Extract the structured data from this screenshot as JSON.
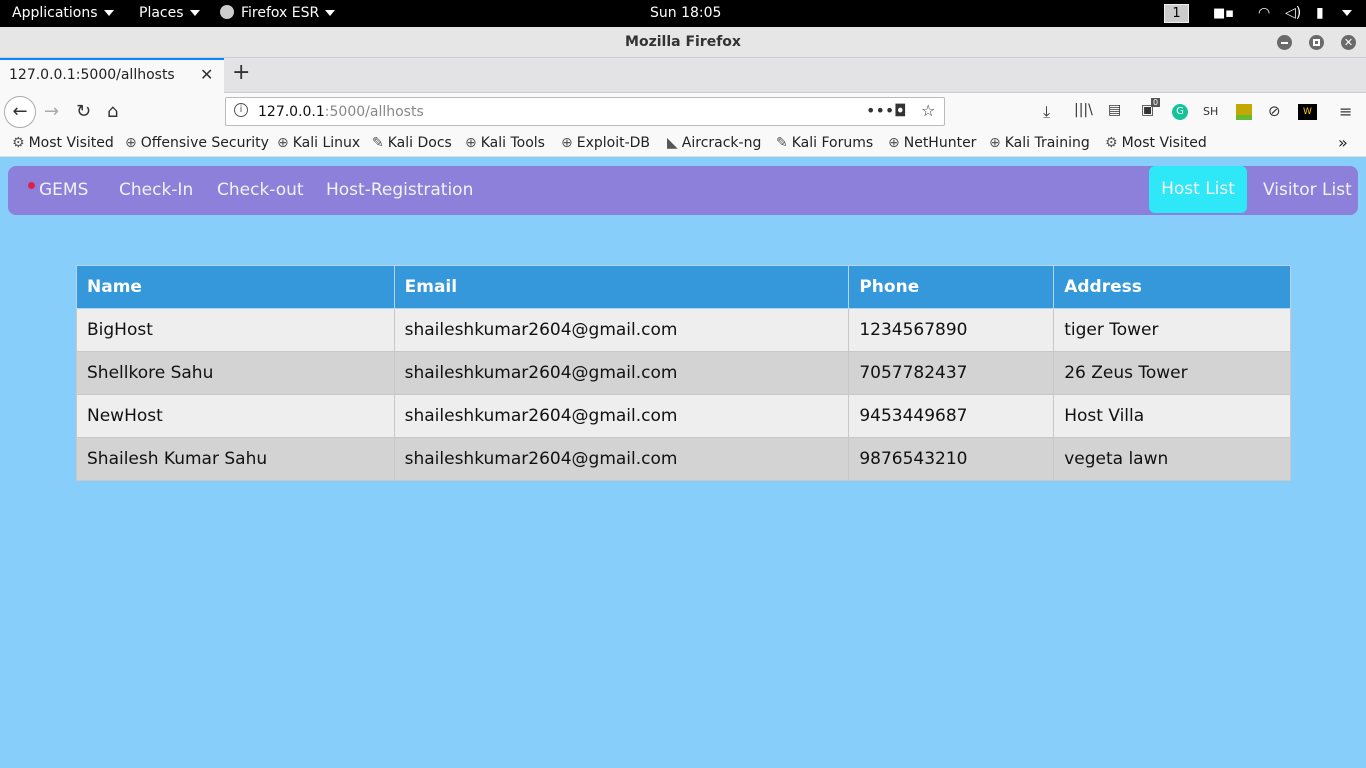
{
  "system_bar": {
    "applications": "Applications",
    "places": "Places",
    "firefox_menu": "Firefox ESR",
    "clock": "Sun 18:05",
    "workspace": "1"
  },
  "window": {
    "title": "Mozilla Firefox"
  },
  "tab": {
    "title": "127.0.0.1:5000/allhosts"
  },
  "url": {
    "host": "127.0.0.1",
    "rest": ":5000/allhosts"
  },
  "toolbar": {
    "badge": "0",
    "sh_label": "SH"
  },
  "bookmarks": [
    {
      "label": "Most Visited",
      "icon": "gear-icon"
    },
    {
      "label": "Offensive Security",
      "icon": "globe-icon"
    },
    {
      "label": "Kali Linux",
      "icon": "globe-icon"
    },
    {
      "label": "Kali Docs",
      "icon": "kali-dragon-icon"
    },
    {
      "label": "Kali Tools",
      "icon": "globe-icon"
    },
    {
      "label": "Exploit-DB",
      "icon": "globe-icon"
    },
    {
      "label": "Aircrack-ng",
      "icon": "aircrack-icon"
    },
    {
      "label": "Kali Forums",
      "icon": "kali-dragon-icon"
    },
    {
      "label": "NetHunter",
      "icon": "globe-icon"
    },
    {
      "label": "Kali Training",
      "icon": "globe-icon"
    },
    {
      "label": "Most Visited",
      "icon": "gear-icon"
    }
  ],
  "app_nav": {
    "brand": "GEMS",
    "links": [
      "Check-In",
      "Check-out",
      "Host-Registration"
    ],
    "host_list": "Host List",
    "visitor_list": "Visitor List"
  },
  "hosts_table": {
    "columns": [
      "Name",
      "Email",
      "Phone",
      "Address"
    ],
    "rows": [
      [
        "BigHost",
        "shaileshkumar2604@gmail.com",
        "1234567890",
        "tiger Tower"
      ],
      [
        "Shellkore Sahu",
        "shaileshkumar2604@gmail.com",
        "7057782437",
        "26 Zeus Tower"
      ],
      [
        "NewHost",
        "shaileshkumar2604@gmail.com",
        "9453449687",
        "Host Villa"
      ],
      [
        "Shailesh Kumar Sahu",
        "shaileshkumar2604@gmail.com",
        "9876543210",
        "vegeta lawn"
      ]
    ]
  },
  "colors": {
    "page_bg": "#87cefa",
    "navbar_bg": "#8c80db",
    "active_nav": "#2ee8f7",
    "table_header": "#3498db"
  }
}
